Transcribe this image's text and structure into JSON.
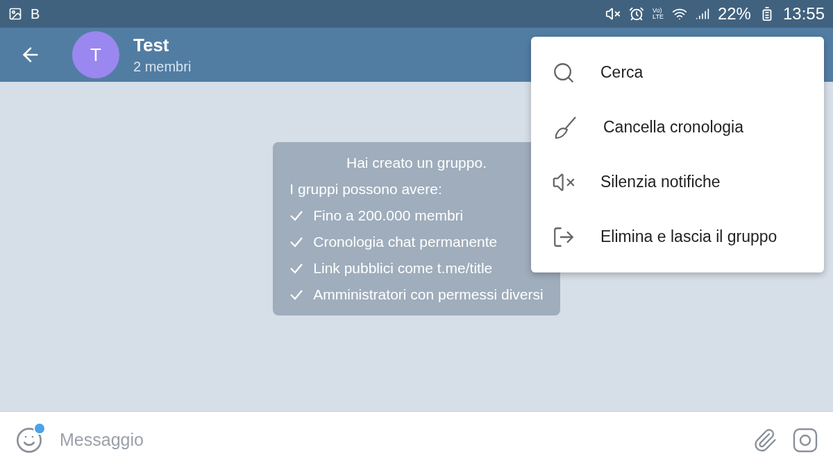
{
  "status_bar": {
    "app_letter": "B",
    "network": [
      "Vo)",
      "LTE"
    ],
    "battery": "22%",
    "time": "13:55"
  },
  "header": {
    "avatar_letter": "T",
    "title": "Test",
    "subtitle": "2 membri"
  },
  "service_message": {
    "title": "Hai creato un gruppo.",
    "intro": "I gruppi possono avere:",
    "features": [
      "Fino a 200.000 membri",
      "Cronologia chat permanente",
      "Link pubblici come t.me/title",
      "Amministratori con permessi diversi"
    ]
  },
  "menu": [
    {
      "kind": "search",
      "label": "Cerca"
    },
    {
      "kind": "clear",
      "label": "Cancella cronologia"
    },
    {
      "kind": "mute",
      "label": "Silenzia notifiche"
    },
    {
      "kind": "leave",
      "label": "Elimina e lascia il gruppo"
    }
  ],
  "composer": {
    "placeholder": "Messaggio",
    "sticker_badge": true
  }
}
